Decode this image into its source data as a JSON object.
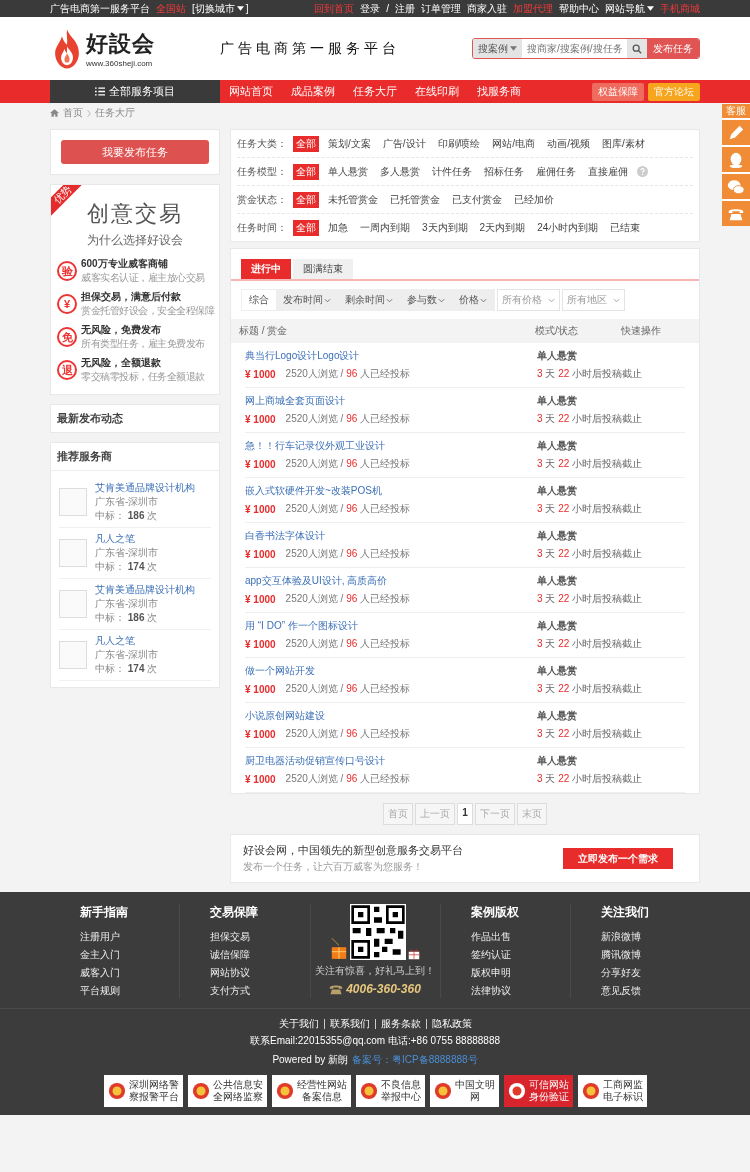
{
  "top_bar": {
    "left": [
      {
        "text": "广告电商第一服务平台",
        "highlight": false,
        "dropdown": false
      },
      {
        "text": "全国站",
        "highlight": true,
        "dropdown": false
      },
      {
        "text": "[切换城市",
        "highlight": false,
        "dropdown": true,
        "suffix": "]"
      }
    ],
    "right": [
      {
        "text": "回到首页",
        "highlight": true,
        "dropdown": false
      },
      {
        "text": "登录",
        "highlight": false,
        "dropdown": false
      },
      {
        "text": "/",
        "highlight": false,
        "dropdown": false
      },
      {
        "text": "注册",
        "highlight": false,
        "dropdown": false
      },
      {
        "text": "订单管理",
        "highlight": false,
        "dropdown": false
      },
      {
        "text": "商家入驻",
        "highlight": false,
        "dropdown": false
      },
      {
        "text": "加盟代理",
        "highlight": true,
        "dropdown": false
      },
      {
        "text": "帮助中心",
        "highlight": false,
        "dropdown": false
      },
      {
        "text": "网站导航",
        "highlight": false,
        "dropdown": true
      },
      {
        "text": "手机商城",
        "highlight": true,
        "dropdown": false
      }
    ]
  },
  "header": {
    "logo_name": "好設会",
    "logo_url": "www.360sheji.com",
    "slogan": "广告电商第一服务平台",
    "search": {
      "scope": "搜案例",
      "placeholder": "搜商家/搜案例/搜任务",
      "button": "发布任务"
    }
  },
  "nav": {
    "all_services": "全部服务项目",
    "items": [
      "网站首页",
      "成品案例",
      "任务大厅",
      "在线印刷",
      "找服务商"
    ],
    "buttons": [
      {
        "label": "权益保障",
        "color": "#ef6b5d"
      },
      {
        "label": "官方论坛",
        "color": "#f7a51c"
      }
    ]
  },
  "breadcrumb": [
    "首页",
    "任务大厅"
  ],
  "float_service": {
    "label": "客服"
  },
  "sidebar": {
    "publish_button": "我要发布任务",
    "promo": {
      "ribbon": "优势",
      "title": "创意交易",
      "subtitle": "为什么选择好设会",
      "features": [
        {
          "badge": "验",
          "title": "600万专业威客商铺",
          "desc": "威客实名认证，雇主放心交易"
        },
        {
          "badge": "¥",
          "title": "担保交易，满意后付款",
          "desc": "赏金托管好设会，安全全程保障"
        },
        {
          "badge": "免",
          "title": "无风险，免费发布",
          "desc": "所有类型任务，雇主免费发布"
        },
        {
          "badge": "退",
          "title": "无风险，全额退款",
          "desc": "零交稿零投标，任务全额退款"
        }
      ]
    },
    "latest_title": "最新发布动态",
    "providers": {
      "title": "推荐服务商",
      "items": [
        {
          "name": "艾肯美通品牌设计机构",
          "region": "广东省-深圳市",
          "wins_label": "中标：",
          "wins": "186",
          "unit": "次"
        },
        {
          "name": "凡人之笔",
          "region": "广东省-深圳市",
          "wins_label": "中标：",
          "wins": "174",
          "unit": "次"
        },
        {
          "name": "艾肯美通品牌设计机构",
          "region": "广东省-深圳市",
          "wins_label": "中标：",
          "wins": "186",
          "unit": "次"
        },
        {
          "name": "凡人之笔",
          "region": "广东省-深圳市",
          "wins_label": "中标：",
          "wins": "174",
          "unit": "次"
        }
      ]
    }
  },
  "filters": [
    {
      "label": "任务大类：",
      "help": false,
      "options": [
        {
          "text": "全部",
          "selected": true
        },
        {
          "text": "策划/文案",
          "selected": false
        },
        {
          "text": "广告/设计",
          "selected": false
        },
        {
          "text": "印刷/喷绘",
          "selected": false
        },
        {
          "text": "网站/电商",
          "selected": false
        },
        {
          "text": "动画/视频",
          "selected": false
        },
        {
          "text": "图库/素材",
          "selected": false
        }
      ]
    },
    {
      "label": "任务模型：",
      "help": true,
      "options": [
        {
          "text": "全部",
          "selected": true
        },
        {
          "text": "单人悬赏",
          "selected": false
        },
        {
          "text": "多人悬赏",
          "selected": false
        },
        {
          "text": "计件任务",
          "selected": false
        },
        {
          "text": "招标任务",
          "selected": false
        },
        {
          "text": "雇佣任务",
          "selected": false
        },
        {
          "text": "直接雇佣",
          "selected": false
        }
      ]
    },
    {
      "label": "赏金状态：",
      "help": false,
      "options": [
        {
          "text": "全部",
          "selected": true
        },
        {
          "text": "未托管赏金",
          "selected": false
        },
        {
          "text": "已托管赏金",
          "selected": false
        },
        {
          "text": "已支付赏金",
          "selected": false
        },
        {
          "text": "已经加价",
          "selected": false
        }
      ]
    },
    {
      "label": "任务时间：",
      "help": false,
      "options": [
        {
          "text": "全部",
          "selected": true
        },
        {
          "text": "加急",
          "selected": false
        },
        {
          "text": "一周内到期",
          "selected": false
        },
        {
          "text": "3天内到期",
          "selected": false
        },
        {
          "text": "2天内到期",
          "selected": false
        },
        {
          "text": "24小时内到期",
          "selected": false
        },
        {
          "text": "已结束",
          "selected": false
        }
      ]
    }
  ],
  "status_tabs": [
    {
      "label": "进行中",
      "selected": true
    },
    {
      "label": "圆满结束",
      "selected": false
    }
  ],
  "sorts": [
    {
      "label": "综合",
      "selected": true,
      "dropdown": false
    },
    {
      "label": "发布时间",
      "selected": false,
      "dropdown": true
    },
    {
      "label": "剩余时间",
      "selected": false,
      "dropdown": true
    },
    {
      "label": "参与数",
      "selected": false,
      "dropdown": true
    },
    {
      "label": "价格",
      "selected": false,
      "dropdown": true
    }
  ],
  "selects": [
    "所有价格",
    "所有地区"
  ],
  "columns": [
    "标题 / 赏金",
    "模式/状态",
    "快速操作"
  ],
  "tasks": [
    {
      "title": "典当行Logo设计Logo设计",
      "price": "¥ 1000",
      "views": "2520人浏览",
      "sep": "/",
      "bids": "96",
      "bids_suffix": "人已经投标",
      "mode": "单人悬赏",
      "days": "3",
      "days_unit": "天",
      "hours": "22",
      "hours_unit": "小时后投稿截止"
    },
    {
      "title": "网上商城全套页面设计",
      "price": "¥ 1000",
      "views": "2520人浏览",
      "sep": "/",
      "bids": "96",
      "bids_suffix": "人已经投标",
      "mode": "单人悬赏",
      "days": "3",
      "days_unit": "天",
      "hours": "22",
      "hours_unit": "小时后投稿截止"
    },
    {
      "title": "急！！行车记录仪外观工业设计",
      "price": "¥ 1000",
      "views": "2520人浏览",
      "sep": "/",
      "bids": "96",
      "bids_suffix": "人已经投标",
      "mode": "单人悬赏",
      "days": "3",
      "days_unit": "天",
      "hours": "22",
      "hours_unit": "小时后投稿截止"
    },
    {
      "title": "嵌入式软硬件开发~改装POS机",
      "price": "¥ 1000",
      "views": "2520人浏览",
      "sep": "/",
      "bids": "96",
      "bids_suffix": "人已经投标",
      "mode": "单人悬赏",
      "days": "3",
      "days_unit": "天",
      "hours": "22",
      "hours_unit": "小时后投稿截止"
    },
    {
      "title": "白香书法字体设计",
      "price": "¥ 1000",
      "views": "2520人浏览",
      "sep": "/",
      "bids": "96",
      "bids_suffix": "人已经投标",
      "mode": "单人悬赏",
      "days": "3",
      "days_unit": "天",
      "hours": "22",
      "hours_unit": "小时后投稿截止"
    },
    {
      "title": "app交互体验及UI设计, 高质高价",
      "price": "¥ 1000",
      "views": "2520人浏览",
      "sep": "/",
      "bids": "96",
      "bids_suffix": "人已经投标",
      "mode": "单人悬赏",
      "days": "3",
      "days_unit": "天",
      "hours": "22",
      "hours_unit": "小时后投稿截止"
    },
    {
      "title": "用 “I DO” 作一个图标设计",
      "price": "¥ 1000",
      "views": "2520人浏览",
      "sep": "/",
      "bids": "96",
      "bids_suffix": "人已经投标",
      "mode": "单人悬赏",
      "days": "3",
      "days_unit": "天",
      "hours": "22",
      "hours_unit": "小时后投稿截止"
    },
    {
      "title": "做一个网站开发",
      "price": "¥ 1000",
      "views": "2520人浏览",
      "sep": "/",
      "bids": "96",
      "bids_suffix": "人已经投标",
      "mode": "单人悬赏",
      "days": "3",
      "days_unit": "天",
      "hours": "22",
      "hours_unit": "小时后投稿截止"
    },
    {
      "title": "小说原创网站建设",
      "price": "¥ 1000",
      "views": "2520人浏览",
      "sep": "/",
      "bids": "96",
      "bids_suffix": "人已经投标",
      "mode": "单人悬赏",
      "days": "3",
      "days_unit": "天",
      "hours": "22",
      "hours_unit": "小时后投稿截止"
    },
    {
      "title": "厨卫电器活动促销宣传口号设计",
      "price": "¥ 1000",
      "views": "2520人浏览",
      "sep": "/",
      "bids": "96",
      "bids_suffix": "人已经投标",
      "mode": "单人悬赏",
      "days": "3",
      "days_unit": "天",
      "hours": "22",
      "hours_unit": "小时后投稿截止"
    }
  ],
  "pagination": [
    {
      "label": "首页",
      "selected": false,
      "disabled": true
    },
    {
      "label": "上一页",
      "selected": false,
      "disabled": true
    },
    {
      "label": "1",
      "selected": true,
      "disabled": false
    },
    {
      "label": "下一页",
      "selected": false,
      "disabled": true
    },
    {
      "label": "末页",
      "selected": false,
      "disabled": true
    }
  ],
  "cta": {
    "title": "好设会网，中国领先的新型创意服务交易平台",
    "subtitle": "发布一个任务，让六百万威客为您服务！",
    "button": "立即发布一个需求"
  },
  "footer": {
    "columns_left": [
      {
        "title": "新手指南",
        "links": [
          "注册用户",
          "金主入门",
          "威客入门",
          "平台规则"
        ]
      },
      {
        "title": "交易保障",
        "links": [
          "担保交易",
          "诚信保障",
          "网站协议",
          "支付方式"
        ]
      }
    ],
    "qr": {
      "caption": "关注有惊喜，好礼马上到！",
      "phone": "4006-360-360"
    },
    "columns_right": [
      {
        "title": "案例版权",
        "links": [
          "作品出售",
          "签约认证",
          "版权申明",
          "法律协议"
        ]
      },
      {
        "title": "关注我们",
        "links": [
          "新浪微博",
          "腾讯微博",
          "分享好友",
          "意见反馈"
        ]
      }
    ],
    "bottom_links": [
      "关于我们",
      "联系我们",
      "服务条款",
      "隐私政策"
    ],
    "contact": "联系Email:22015355@qq.com 电话:+86 0755 88888888",
    "powered": "Powered by 新朗",
    "icp": "备案号：粤ICP备8888888号",
    "badges": [
      {
        "lines": [
          "深圳网络警",
          "察报警平台"
        ],
        "highlight": false
      },
      {
        "lines": [
          "公共信息安",
          "全网络监察"
        ],
        "highlight": false
      },
      {
        "lines": [
          "经营性网站",
          "备案信息"
        ],
        "highlight": false
      },
      {
        "lines": [
          "不良信息",
          "举报中心"
        ],
        "highlight": false
      },
      {
        "lines": [
          "中国文明",
          "网"
        ],
        "highlight": false
      },
      {
        "lines": [
          "可信网站",
          "身份验证"
        ],
        "highlight": true
      },
      {
        "lines": [
          "工商网监",
          "电子标识"
        ],
        "highlight": false
      }
    ]
  }
}
